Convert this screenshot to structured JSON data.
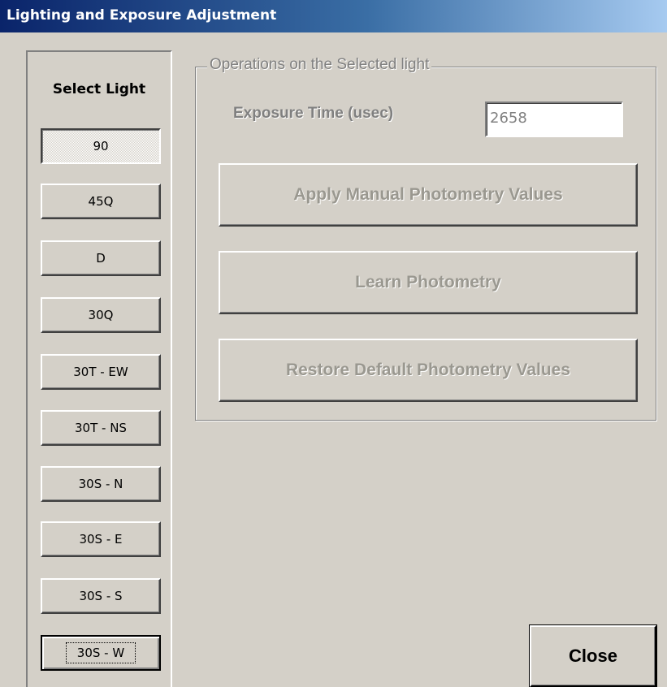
{
  "window": {
    "title": "Lighting and Exposure Adjustment"
  },
  "lights": {
    "heading": "Select Light",
    "items": [
      {
        "label": "90",
        "state": "selected"
      },
      {
        "label": "45Q",
        "state": "normal"
      },
      {
        "label": "D",
        "state": "normal"
      },
      {
        "label": "30Q",
        "state": "normal"
      },
      {
        "label": "30T - EW",
        "state": "normal"
      },
      {
        "label": "30T - NS",
        "state": "normal"
      },
      {
        "label": "30S - N",
        "state": "normal"
      },
      {
        "label": "30S - E",
        "state": "normal"
      },
      {
        "label": "30S - S",
        "state": "normal"
      },
      {
        "label": "30S - W",
        "state": "focused"
      }
    ]
  },
  "operations": {
    "group_label": "Operations on the Selected light",
    "exposure_label": "Exposure Time (usec)",
    "exposure_value": "2658",
    "apply_label": "Apply Manual Photometry Values",
    "learn_label": "Learn Photometry",
    "restore_label": "Restore Default Photometry Values",
    "enabled": false
  },
  "footer": {
    "close_label": "Close"
  },
  "colors": {
    "face": "#d4d0c8",
    "title_start": "#0a246a",
    "title_end": "#a6caf0",
    "disabled_text": "#808080"
  }
}
